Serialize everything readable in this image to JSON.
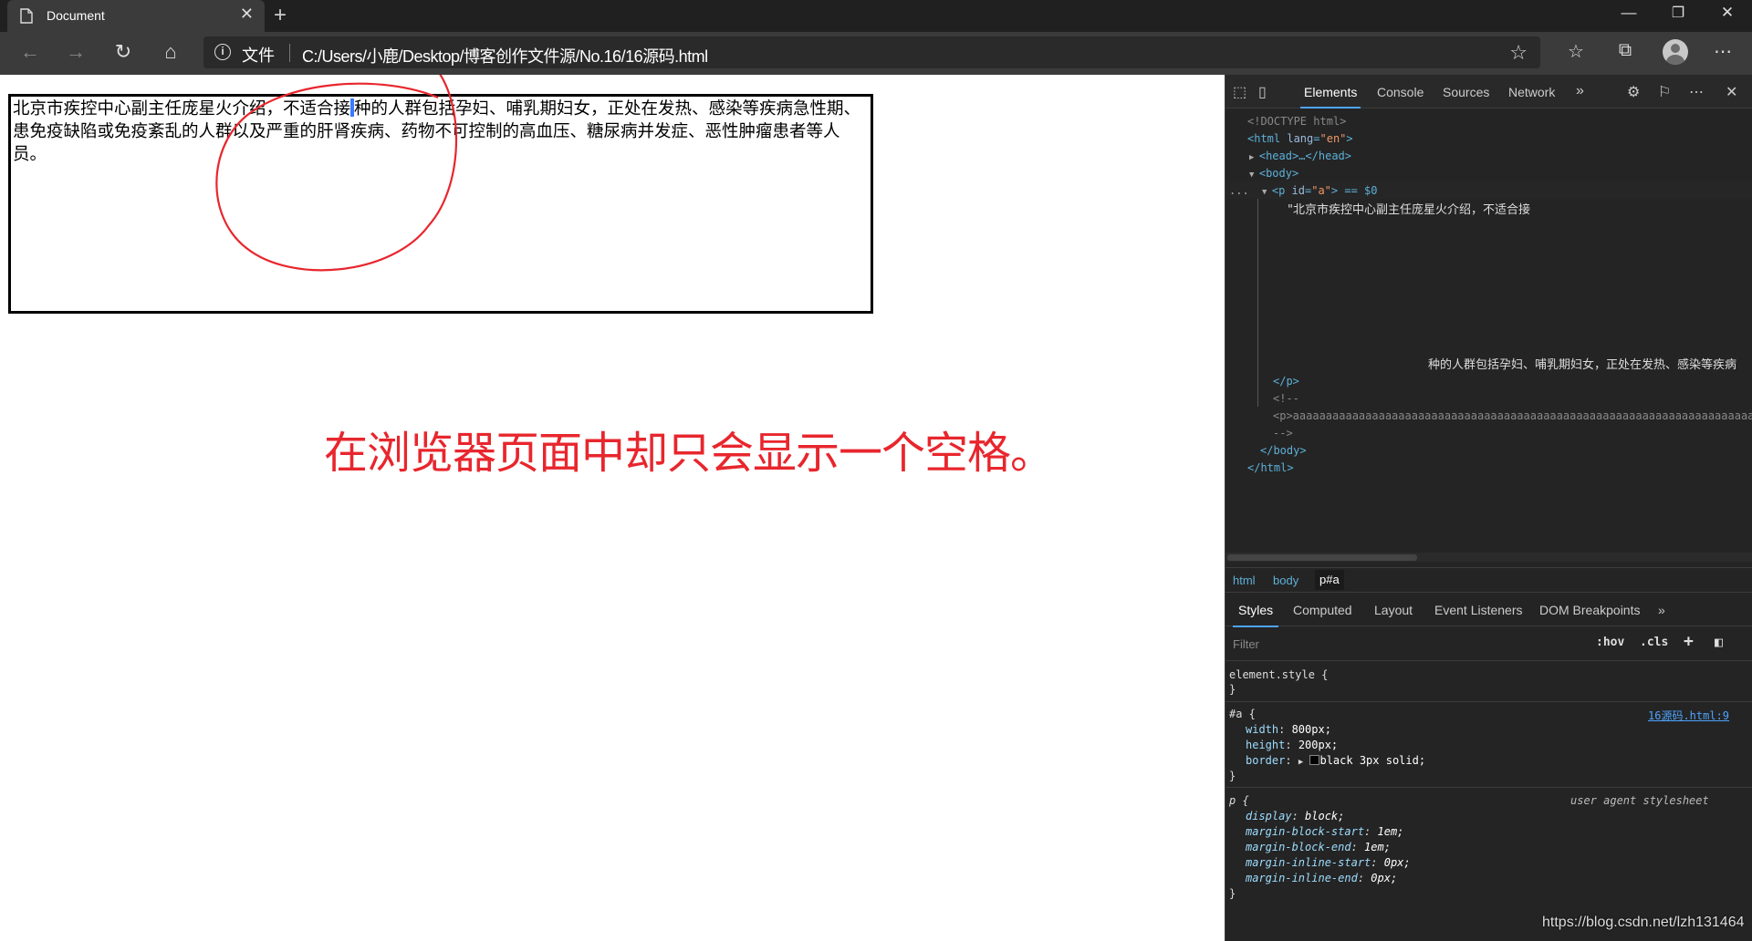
{
  "browser": {
    "tab_title": "Document",
    "address_prefix": "文件",
    "url": "C:/Users/小鹿/Desktop/博客创作文件源/No.16/16源码.html"
  },
  "page": {
    "para_before_caret": "北京市疾控中心副主任庞星火介绍，不适合接",
    "para_after_caret": "种的人群包括孕妇、哺乳期妇女，正处在发热、感染等疾病急性期、患免疫缺陷或免疫紊乱的人群以及严重的肝肾疾病、药物不可控制的高血压、糖尿病并发症、恶性肿瘤患者等人员。",
    "caption": "在浏览器页面中却只会显示一个空格。"
  },
  "devtools": {
    "tabs": [
      "Elements",
      "Console",
      "Sources",
      "Network"
    ],
    "tree": {
      "doctype": "<!DOCTYPE html>",
      "html_open_tag": "<html",
      "html_attr": "lang",
      "html_val": "\"en\"",
      "head": "<head>…</head>",
      "body_open": "<body>",
      "p_open": "<p",
      "p_attr": "id",
      "p_val": "\"a\"",
      "p_suffix": "> == $0",
      "text1": "\"北京市疾控中心副主任庞星火介绍，不适合接",
      "text2": "种的人群包括孕妇、哺乳期妇女，正处在发热、感染等疾病",
      "p_close": "</p>",
      "comment_open": "<!--",
      "comment_text": "<p>aaaaaaaaaaaaaaaaaaaaaaaaaaaaaaaaaaaaaaaaaaaaaaaaaaaaaaaaaaaaaaaaaaaaaaaaaa",
      "comment_close": "-->",
      "body_close": "</body>",
      "html_close": "</html>",
      "ellipsis": "..."
    },
    "breadcrumbs": [
      "html",
      "body",
      "p#a"
    ],
    "style_tabs": [
      "Styles",
      "Computed",
      "Layout",
      "Event Listeners",
      "DOM Breakpoints"
    ],
    "filter_placeholder": "Filter",
    "hov": ":hov",
    "cls": ".cls",
    "rules": {
      "element_style": "element.style {",
      "close": "}",
      "a_selector": "#a {",
      "a_source": "16源码.html:9",
      "a_props": [
        {
          "name": "width",
          "value": "800px;"
        },
        {
          "name": "height",
          "value": "200px;"
        },
        {
          "name": "border",
          "value": "black 3px solid;"
        }
      ],
      "p_selector": "p {",
      "p_source": "user agent stylesheet",
      "p_props": [
        {
          "name": "display",
          "value": "block;"
        },
        {
          "name": "margin-block-start",
          "value": "1em;"
        },
        {
          "name": "margin-block-end",
          "value": "1em;"
        },
        {
          "name": "margin-inline-start",
          "value": "0px;"
        },
        {
          "name": "margin-inline-end",
          "value": "0px;"
        }
      ]
    }
  },
  "watermark": "https://blog.csdn.net/lzh131464",
  "colors": {
    "caption": "#e8262d",
    "accent": "#4da3ff",
    "caret": "#3a7afe"
  }
}
